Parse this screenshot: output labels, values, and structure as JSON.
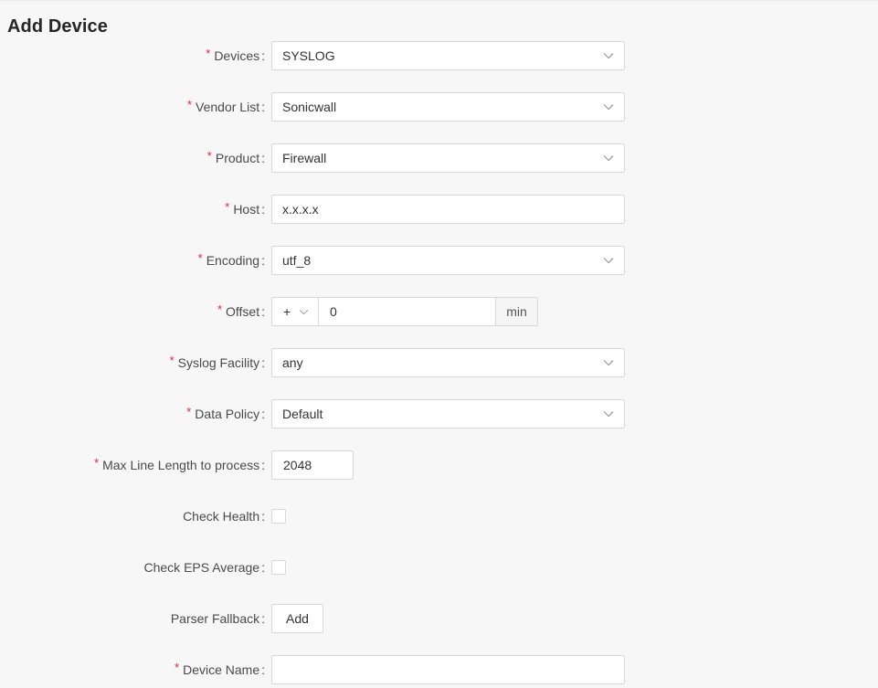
{
  "page": {
    "title": "Add Device"
  },
  "form": {
    "devices": {
      "label": "Devices",
      "value": "SYSLOG"
    },
    "vendor_list": {
      "label": "Vendor List",
      "value": "Sonicwall"
    },
    "product": {
      "label": "Product",
      "value": "Firewall"
    },
    "host": {
      "label": "Host",
      "value": "x.x.x.x"
    },
    "encoding": {
      "label": "Encoding",
      "value": "utf_8"
    },
    "offset": {
      "label": "Offset",
      "sign": "+",
      "value": "0",
      "unit": "min"
    },
    "syslog_facility": {
      "label": "Syslog Facility",
      "value": "any"
    },
    "data_policy": {
      "label": "Data Policy",
      "value": "Default"
    },
    "max_line_length": {
      "label": "Max Line Length to process",
      "value": "2048"
    },
    "check_health": {
      "label": "Check Health",
      "checked": false
    },
    "check_eps_average": {
      "label": "Check EPS Average",
      "checked": false
    },
    "parser_fallback": {
      "label": "Parser Fallback",
      "button_label": "Add"
    },
    "device_name": {
      "label": "Device Name",
      "value": ""
    }
  },
  "required_marker": "*",
  "label_separator": ":",
  "icons": {
    "dropdown": "chevron-down-icon"
  },
  "colors": {
    "required": "#f5222d",
    "border": "#d9d9d9",
    "background": "#f7f7f7"
  }
}
